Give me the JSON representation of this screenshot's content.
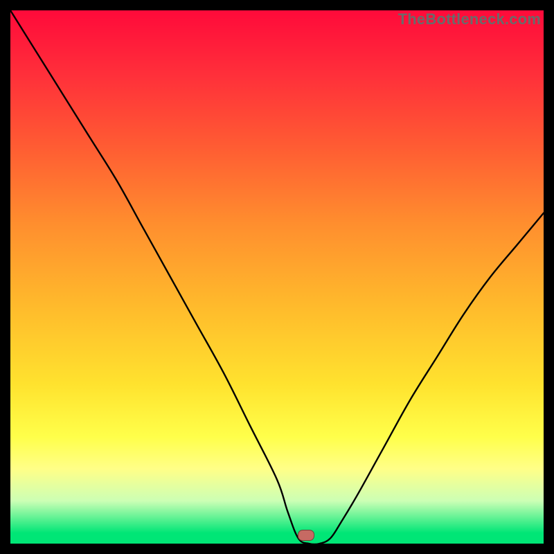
{
  "watermark": "TheBottleneck.com",
  "marker": {
    "x_pct": 55.5,
    "y_pct": 98.5
  },
  "chart_data": {
    "type": "line",
    "title": "",
    "xlabel": "",
    "ylabel": "",
    "ylim": [
      0,
      100
    ],
    "xlim": [
      0,
      100
    ],
    "series": [
      {
        "name": "bottleneck-curve",
        "x": [
          0,
          5,
          10,
          15,
          20,
          25,
          30,
          35,
          40,
          45,
          50,
          52,
          54,
          56,
          58,
          60,
          62,
          65,
          70,
          75,
          80,
          85,
          90,
          95,
          100
        ],
        "values": [
          100,
          92,
          84,
          76,
          68,
          59,
          50,
          41,
          32,
          22,
          12,
          6,
          1,
          0,
          0,
          1,
          4,
          9,
          18,
          27,
          35,
          43,
          50,
          56,
          62
        ]
      }
    ],
    "gradient_stops": [
      {
        "pct": 0,
        "color": "#ff0a3a"
      },
      {
        "pct": 25,
        "color": "#ff5a33"
      },
      {
        "pct": 55,
        "color": "#ffb92c"
      },
      {
        "pct": 80,
        "color": "#ffff4a"
      },
      {
        "pct": 92,
        "color": "#ccffb5"
      },
      {
        "pct": 100,
        "color": "#00e676"
      }
    ]
  }
}
